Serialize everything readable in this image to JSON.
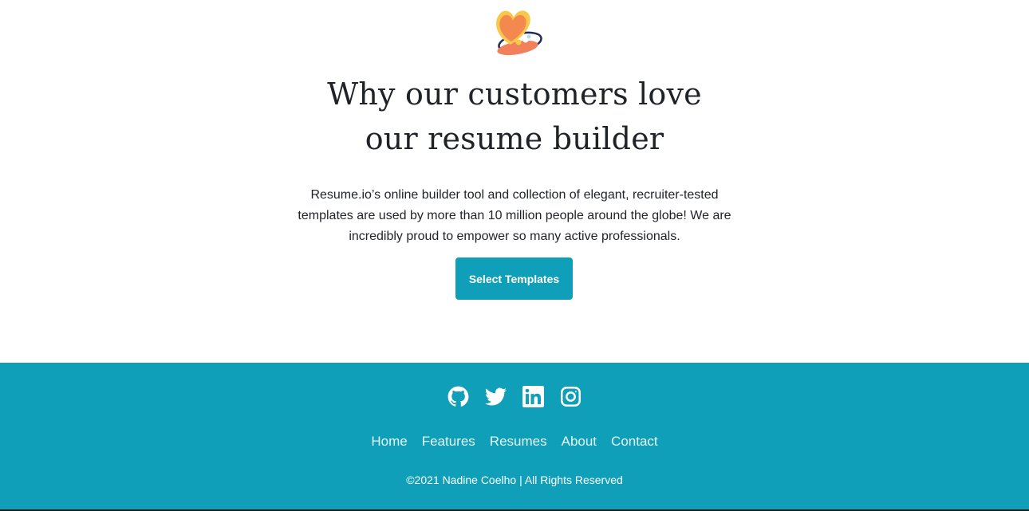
{
  "hero": {
    "icon": "hearts-illustration-icon",
    "headline_line1": "Why our customers love",
    "headline_line2": "our resume builder",
    "description": "Resume.io’s online builder tool and collection of elegant, recruiter-tested templates are used by more than 10 million people around the globe! We are incredibly proud to empower so many active professionals.",
    "cta_label": "Select Templates"
  },
  "footer": {
    "social": [
      {
        "icon": "github-icon"
      },
      {
        "icon": "twitter-icon"
      },
      {
        "icon": "linkedin-icon"
      },
      {
        "icon": "instagram-icon"
      }
    ],
    "nav": [
      {
        "label": "Home"
      },
      {
        "label": "Features"
      },
      {
        "label": "Resumes"
      },
      {
        "label": "About"
      },
      {
        "label": "Contact"
      }
    ],
    "copyright": "©2021 Nadine Coelho | All Rights Reserved"
  },
  "colors": {
    "accent": "#0f9fb8",
    "text": "#1f2226",
    "footer_text": "#ffffff"
  }
}
